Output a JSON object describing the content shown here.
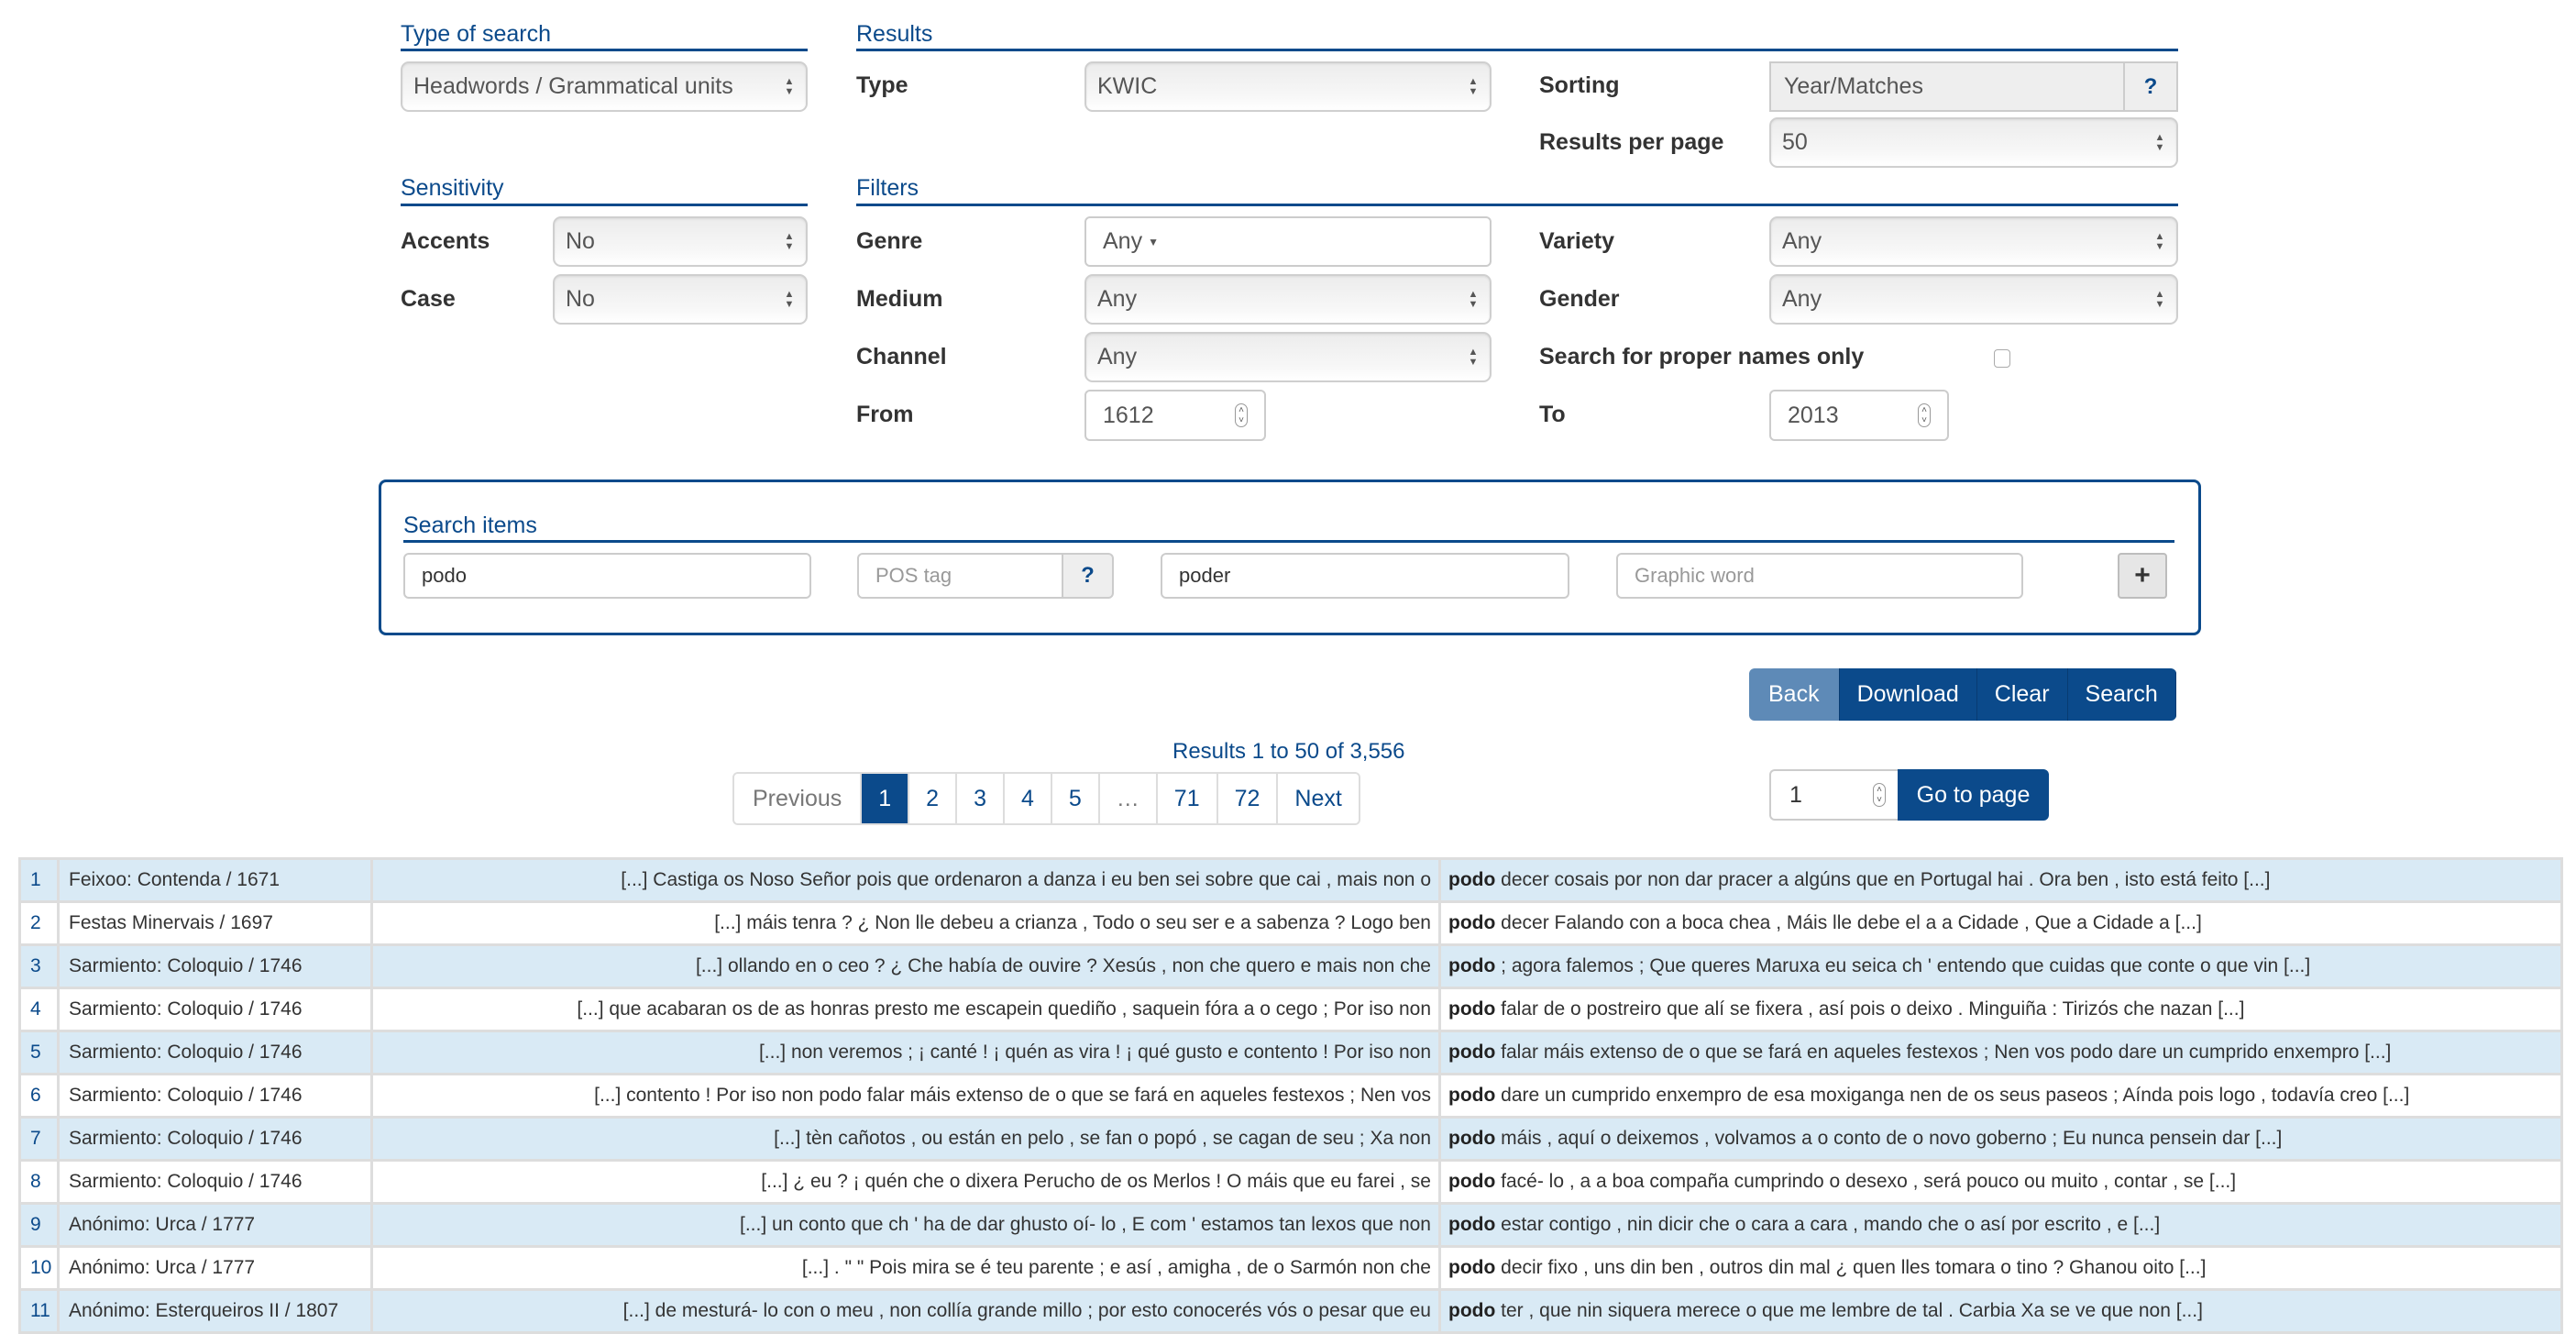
{
  "type_of_search": {
    "title": "Type of search",
    "value": "Headwords / Grammatical units"
  },
  "results": {
    "title": "Results",
    "type_label": "Type",
    "type_value": "KWIC",
    "sorting_label": "Sorting",
    "sorting_value": "Year/Matches",
    "sorting_help": "?",
    "per_page_label": "Results per page",
    "per_page_value": "50"
  },
  "sensitivity": {
    "title": "Sensitivity",
    "accents_label": "Accents",
    "accents_value": "No",
    "case_label": "Case",
    "case_value": "No"
  },
  "filters": {
    "title": "Filters",
    "genre_label": "Genre",
    "genre_value": "Any",
    "medium_label": "Medium",
    "medium_value": "Any",
    "channel_label": "Channel",
    "channel_value": "Any",
    "from_label": "From",
    "from_value": "1612",
    "variety_label": "Variety",
    "variety_value": "Any",
    "gender_label": "Gender",
    "gender_value": "Any",
    "proper_names_label": "Search for proper names only",
    "proper_names_checked": false,
    "to_label": "To",
    "to_value": "2013"
  },
  "search_items": {
    "title": "Search items",
    "word_value": "podo",
    "pos_placeholder": "POS tag",
    "pos_help": "?",
    "lemma_value": "poder",
    "graphic_placeholder": "Graphic word",
    "add_label": "+"
  },
  "actions": {
    "back": "Back",
    "download": "Download",
    "clear": "Clear",
    "search": "Search"
  },
  "pagination": {
    "summary": "Results 1 to 50 of 3,556",
    "previous": "Previous",
    "pages": [
      "1",
      "2",
      "3",
      "4",
      "5",
      "…",
      "71",
      "72"
    ],
    "current_page": "1",
    "next": "Next",
    "goto_value": "1",
    "goto_label": "Go to page"
  },
  "colors": {
    "brand": "#0b4a8b",
    "row_alt": "#d9eaf5",
    "back_button": "#5e8ab7"
  },
  "rows": [
    {
      "n": "1",
      "source": "Feixoo: Contenda / 1671",
      "left": "[...] Castiga os Noso Señor pois que ordenaron a danza i eu ben sei sobre que cai , mais non o",
      "match": "podo",
      "right": "decer cosais por non dar pracer a algúns que en Portugal hai . Ora ben , isto está feito [...]"
    },
    {
      "n": "2",
      "source": "Festas Minervais / 1697",
      "left": "[...] máis tenra ? ¿ Non lle debeu a crianza , Todo o seu ser e a sabenza ? Logo ben",
      "match": "podo",
      "right": "decer Falando con a boca chea , Máis lle debe el a a Cidade , Que a Cidade a [...]"
    },
    {
      "n": "3",
      "source": "Sarmiento: Coloquio / 1746",
      "left": "[...] ollando en o ceo ? ¿ Che había de ouvire ? Xesús , non che quero e mais non che",
      "match": "podo",
      "right": "; agora falemos ; Que queres Maruxa eu seica ch ' entendo que cuidas que conte o que vin [...]"
    },
    {
      "n": "4",
      "source": "Sarmiento: Coloquio / 1746",
      "left": "[...] que acabaran os de as honras presto me escapein quediño , saquein fóra a o cego ; Por iso non",
      "match": "podo",
      "right": "falar de o postreiro que alí se fixera , así pois o deixo . Minguiña : Tirizós che nazan [...]"
    },
    {
      "n": "5",
      "source": "Sarmiento: Coloquio / 1746",
      "left": "[...] non veremos ; ¡ canté ! ¡ quén as vira ! ¡ qué gusto e contento ! Por iso non",
      "match": "podo",
      "right": "falar máis extenso de o que se fará en aqueles festexos ; Nen vos podo dare un cumprido enxempro [...]"
    },
    {
      "n": "6",
      "source": "Sarmiento: Coloquio / 1746",
      "left": "[...] contento ! Por iso non podo falar máis extenso de o que se fará en aqueles festexos ; Nen vos",
      "match": "podo",
      "right": "dare un cumprido enxempro de esa moxiganga nen de os seus paseos ; Aínda pois logo , todavía creo [...]"
    },
    {
      "n": "7",
      "source": "Sarmiento: Coloquio / 1746",
      "left": "[...] tèn cañotos , ou están en pelo , se fan o popó , se cagan de seu ; Xa non",
      "match": "podo",
      "right": "máis , aquí o deixemos , volvamos a o conto de o novo goberno ; Eu nunca pensein dar [...]"
    },
    {
      "n": "8",
      "source": "Sarmiento: Coloquio / 1746",
      "left": "[...] ¿ eu ? ¡ quén che o dixera Perucho de os Merlos ! O máis que eu farei , se",
      "match": "podo",
      "right": "facé- lo , a a boa compaña cumprindo o desexo , será pouco ou muito , contar , se [...]"
    },
    {
      "n": "9",
      "source": "Anónimo: Urca / 1777",
      "left": "[...] un conto que ch ' ha de dar ghusto oí- lo , E com ' estamos tan lexos que non",
      "match": "podo",
      "right": "estar contigo , nin dicir che o cara a cara , mando che o así por escrito , e [...]"
    },
    {
      "n": "10",
      "source": "Anónimo: Urca / 1777",
      "left": "[...] . \" \" Pois mira se é teu parente ; e así , amigha , de o Sarmón non che",
      "match": "podo",
      "right": "decir fixo , uns din ben , outros din mal ¿ quen lles tomara o tino ? Ghanou oito [...]"
    },
    {
      "n": "11",
      "source": "Anónimo: Esterqueiros II / 1807",
      "left": "[...] de mesturá- lo con o meu , non collía grande millo ; por esto conocerés vós o pesar que eu",
      "match": "podo",
      "right": "ter , que nin siquera merece o que me lembre de tal . Carbia Xa se ve que non [...]"
    }
  ]
}
